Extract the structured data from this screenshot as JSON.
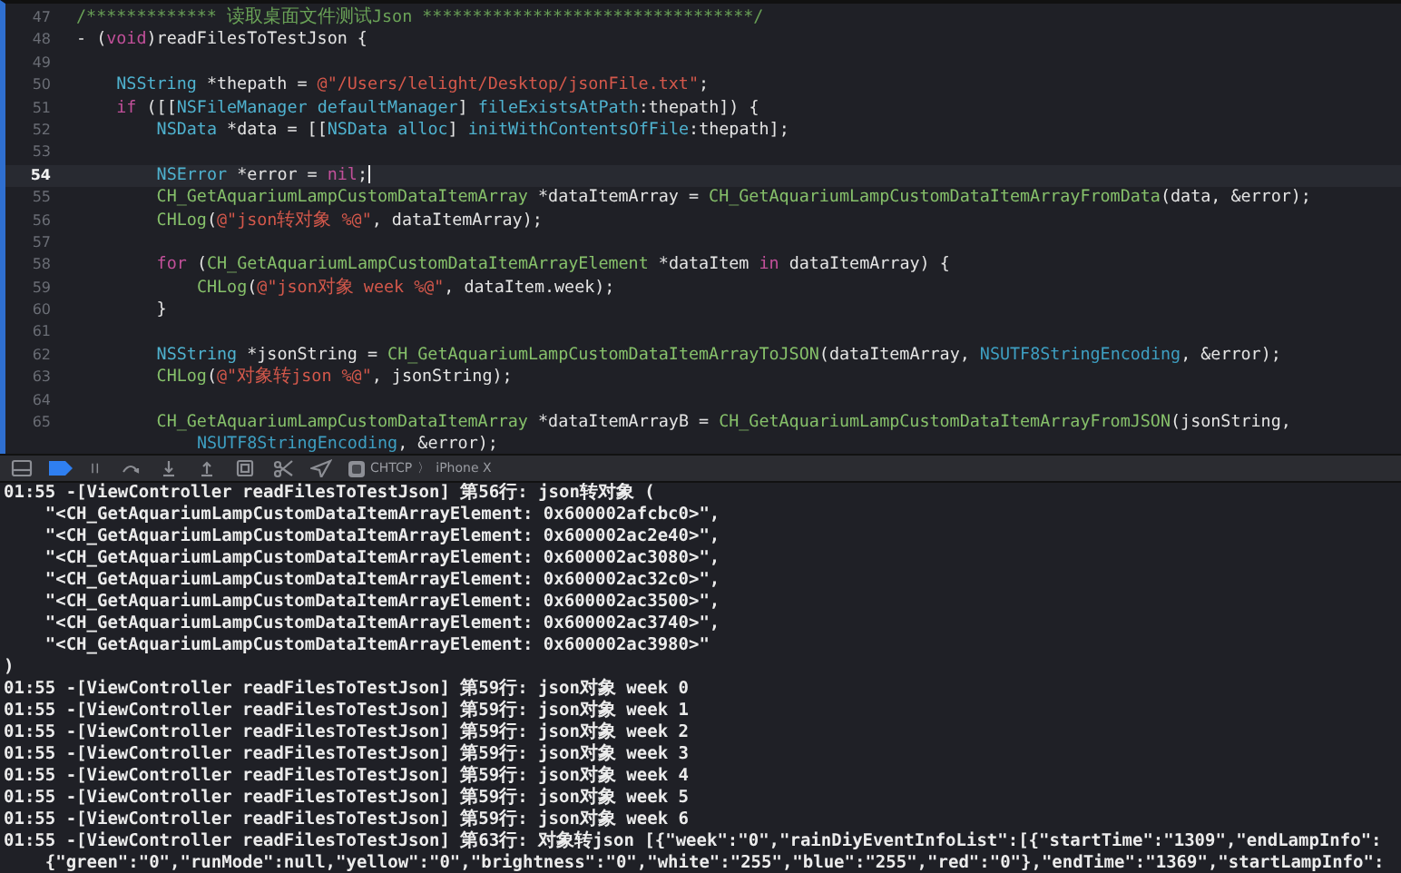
{
  "editor": {
    "lines": [
      {
        "number": "47",
        "current": false,
        "tokens": [
          {
            "kind": "comment",
            "text": "/************* 读取桌面文件测试Json *********************************/"
          }
        ]
      },
      {
        "number": "48",
        "current": false,
        "tokens": [
          {
            "kind": "plain",
            "text": "- ("
          },
          {
            "kind": "keyword",
            "text": "void"
          },
          {
            "kind": "plain",
            "text": ")readFilesToTestJson {"
          }
        ],
        "children": [
          {
            "number": "49",
            "current": false
          },
          {
            "number": "50",
            "current": false,
            "tokens": [
              {
                "kind": "type",
                "text": "NSString"
              },
              {
                "kind": "plain",
                "text": " *thepath = "
              },
              {
                "kind": "string",
                "text": "@\"/Users/lelight/Desktop/jsonFile.txt\""
              },
              {
                "kind": "plain",
                "text": ";"
              }
            ]
          },
          {
            "number": "51",
            "current": false,
            "tokens": [
              {
                "kind": "keyword",
                "text": "if"
              },
              {
                "kind": "plain",
                "text": " ([["
              },
              {
                "kind": "type",
                "text": "NSFileManager"
              },
              {
                "kind": "type",
                "text": " defaultManager"
              },
              {
                "kind": "plain",
                "text": "] "
              },
              {
                "kind": "type",
                "text": "fileExistsAtPath"
              },
              {
                "kind": "plain",
                "text": ":thepath]) {"
              }
            ],
            "children": [
              {
                "number": "52",
                "current": false,
                "tokens": [
                  {
                    "kind": "type",
                    "text": "NSData"
                  },
                  {
                    "kind": "plain",
                    "text": " *data = [["
                  },
                  {
                    "kind": "type",
                    "text": "NSData"
                  },
                  {
                    "kind": "type",
                    "text": " alloc"
                  },
                  {
                    "kind": "plain",
                    "text": "] "
                  },
                  {
                    "kind": "type",
                    "text": "initWithContentsOfFile"
                  },
                  {
                    "kind": "plain",
                    "text": ":thepath];"
                  }
                ]
              },
              {
                "number": "53",
                "current": false
              },
              {
                "number": "54",
                "current": true,
                "tokens": [
                  {
                    "kind": "type",
                    "text": "NSError"
                  },
                  {
                    "kind": "plain",
                    "text": " *error = "
                  },
                  {
                    "kind": "keyword",
                    "text": "nil"
                  },
                  {
                    "kind": "plain",
                    "text": ";"
                  }
                ]
              },
              {
                "number": "55",
                "current": false,
                "tokens": [
                  {
                    "kind": "func",
                    "text": "CH_GetAquariumLampCustomDataItemArray"
                  },
                  {
                    "kind": "plain",
                    "text": " *dataItemArray = "
                  },
                  {
                    "kind": "func",
                    "text": "CH_GetAquariumLampCustomDataItemArrayFromData"
                  },
                  {
                    "kind": "plain",
                    "text": "(data, &error);"
                  }
                ]
              },
              {
                "number": "56",
                "current": false,
                "tokens": [
                  {
                    "kind": "func",
                    "text": "CHLog"
                  },
                  {
                    "kind": "plain",
                    "text": "("
                  },
                  {
                    "kind": "string",
                    "text": "@\"json转对象 %@\""
                  },
                  {
                    "kind": "plain",
                    "text": ", dataItemArray);"
                  }
                ]
              },
              {
                "number": "57",
                "current": false
              },
              {
                "number": "58",
                "current": false,
                "tokens": [
                  {
                    "kind": "keyword",
                    "text": "for"
                  },
                  {
                    "kind": "plain",
                    "text": " ("
                  },
                  {
                    "kind": "func",
                    "text": "CH_GetAquariumLampCustomDataItemArrayElement"
                  },
                  {
                    "kind": "plain",
                    "text": " *dataItem "
                  },
                  {
                    "kind": "keyword",
                    "text": "in"
                  },
                  {
                    "kind": "plain",
                    "text": " dataItemArray) {"
                  }
                ],
                "children": [
                  {
                    "number": "59",
                    "current": false,
                    "tokens": [
                      {
                        "kind": "func",
                        "text": "CHLog"
                      },
                      {
                        "kind": "plain",
                        "text": "("
                      },
                      {
                        "kind": "string",
                        "text": "@\"json对象 week %@\""
                      },
                      {
                        "kind": "plain",
                        "text": ", dataItem.week);"
                      }
                    ]
                  }
                ]
              },
              {
                "number": "60",
                "current": false,
                "tokens": [
                  {
                    "kind": "plain",
                    "text": "}"
                  }
                ]
              },
              {
                "number": "61",
                "current": false
              },
              {
                "number": "62",
                "current": false,
                "tokens": [
                  {
                    "kind": "type",
                    "text": "NSString"
                  },
                  {
                    "kind": "plain",
                    "text": " *jsonString = "
                  },
                  {
                    "kind": "func",
                    "text": "CH_GetAquariumLampCustomDataItemArrayToJSON"
                  },
                  {
                    "kind": "plain",
                    "text": "(dataItemArray, "
                  },
                  {
                    "kind": "const",
                    "text": "NSUTF8StringEncoding"
                  },
                  {
                    "kind": "plain",
                    "text": ", &error);"
                  }
                ]
              },
              {
                "number": "63",
                "current": false,
                "tokens": [
                  {
                    "kind": "func",
                    "text": "CHLog"
                  },
                  {
                    "kind": "plain",
                    "text": "("
                  },
                  {
                    "kind": "string",
                    "text": "@\"对象转json %@\""
                  },
                  {
                    "kind": "plain",
                    "text": ", jsonString);"
                  }
                ]
              },
              {
                "number": "64",
                "current": false
              },
              {
                "number": "65",
                "current": false,
                "tokens": [
                  {
                    "kind": "func",
                    "text": "CH_GetAquariumLampCustomDataItemArray"
                  },
                  {
                    "kind": "plain",
                    "text": " *dataItemArrayB = "
                  },
                  {
                    "kind": "func",
                    "text": "CH_GetAquariumLampCustomDataItemArrayFromJSON"
                  },
                  {
                    "kind": "plain",
                    "text": "(jsonString,"
                  }
                ],
                "children": [
                  {
                    "current": false,
                    "tokens": [
                      {
                        "kind": "const",
                        "text": "NSUTF8StringEncoding"
                      },
                      {
                        "kind": "plain",
                        "text": ", &error);"
                      }
                    ]
                  }
                ]
              }
            ]
          }
        ]
      }
    ]
  },
  "debug_bar": {
    "scheme": "CHTCP",
    "separator": "〉",
    "device": "iPhone X"
  },
  "console": {
    "lines": [
      {
        "text": "01:55 -[ViewController readFilesToTestJson] 第56行: json转对象 (",
        "children": [
          {
            "text": "\"<CH_GetAquariumLampCustomDataItemArrayElement: 0x600002afcbc0>\","
          },
          {
            "text": "\"<CH_GetAquariumLampCustomDataItemArrayElement: 0x600002ac2e40>\","
          },
          {
            "text": "\"<CH_GetAquariumLampCustomDataItemArrayElement: 0x600002ac3080>\","
          },
          {
            "text": "\"<CH_GetAquariumLampCustomDataItemArrayElement: 0x600002ac32c0>\","
          },
          {
            "text": "\"<CH_GetAquariumLampCustomDataItemArrayElement: 0x600002ac3500>\","
          },
          {
            "text": "\"<CH_GetAquariumLampCustomDataItemArrayElement: 0x600002ac3740>\","
          },
          {
            "text": "\"<CH_GetAquariumLampCustomDataItemArrayElement: 0x600002ac3980>\""
          }
        ]
      },
      {
        "text": ")"
      },
      {
        "text": "01:55 -[ViewController readFilesToTestJson] 第59行: json对象 week 0"
      },
      {
        "text": "01:55 -[ViewController readFilesToTestJson] 第59行: json对象 week 1"
      },
      {
        "text": "01:55 -[ViewController readFilesToTestJson] 第59行: json对象 week 2"
      },
      {
        "text": "01:55 -[ViewController readFilesToTestJson] 第59行: json对象 week 3"
      },
      {
        "text": "01:55 -[ViewController readFilesToTestJson] 第59行: json对象 week 4"
      },
      {
        "text": "01:55 -[ViewController readFilesToTestJson] 第59行: json对象 week 5"
      },
      {
        "text": "01:55 -[ViewController readFilesToTestJson] 第59行: json对象 week 6"
      },
      {
        "text": "01:55 -[ViewController readFilesToTestJson] 第63行: 对象转json [{\"week\":\"0\",\"rainDiyEventInfoList\":[{\"startTime\":\"1309\",\"endLampInfo\":",
        "children": [
          {
            "text": "{\"green\":\"0\",\"runMode\":null,\"yellow\":\"0\",\"brightness\":\"0\",\"white\":\"255\",\"blue\":\"255\",\"red\":\"0\"},\"endTime\":\"1369\",\"startLampInfo\":"
          }
        ]
      }
    ]
  }
}
